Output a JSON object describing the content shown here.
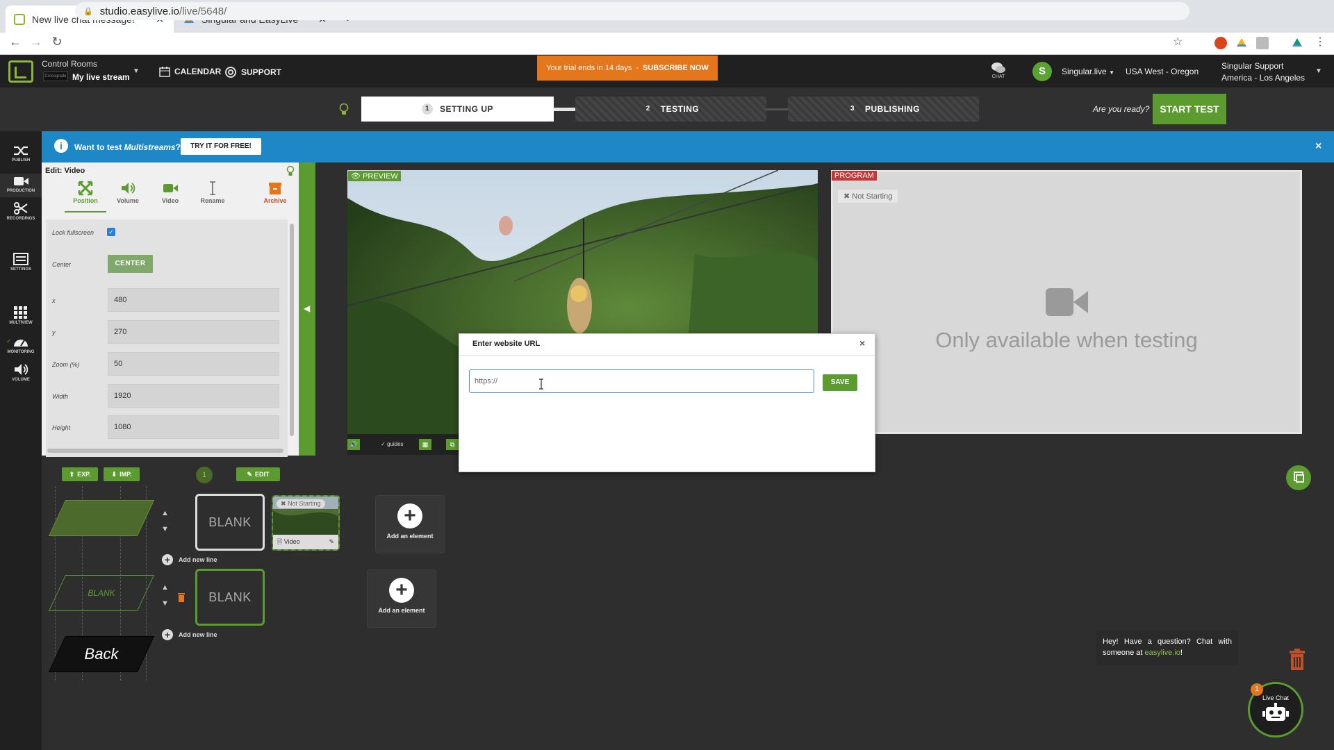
{
  "browser": {
    "tabs": [
      {
        "title": "New live chat message!",
        "icon": "easylive-icon"
      },
      {
        "title": "Singular and EasyLive",
        "icon": "google-drive-icon"
      }
    ],
    "new_tab": "+",
    "url_host": "studio.easylive.io",
    "url_path": "/live/5648/"
  },
  "topbar": {
    "control_rooms": "Control Rooms",
    "room_thumb_label": "Crossgrade",
    "room_name": "My live stream",
    "calendar": "CALENDAR",
    "support": "SUPPORT",
    "trial_text": "Your trial ends in 14 days",
    "trial_sep": "-",
    "trial_cta": "SUBSCRIBE NOW",
    "chat_label": "CHAT",
    "avatar_letter": "S",
    "account": "Singular.live",
    "region": "USA West - Oregon",
    "support_name": "Singular Support",
    "support_tz": "America - Los Angeles"
  },
  "steps": [
    {
      "num": "1",
      "label": "SETTING UP"
    },
    {
      "num": "2",
      "label": "TESTING"
    },
    {
      "num": "3",
      "label": "PUBLISHING"
    }
  ],
  "ready_text": "Are you ready?",
  "start_test": "START TEST",
  "sidebar": [
    "PUBLISH",
    "PRODUCTION",
    "RECORDINGS",
    "SETTINGS",
    "MULTIVIEW",
    "MONITORING",
    "VOLUME"
  ],
  "banner": {
    "info": "i",
    "text_before": "Want to test ",
    "text_em": "Multistreams",
    "text_after": "?",
    "cta": "TRY IT FOR FREE!",
    "close": "×"
  },
  "edit": {
    "title": "Edit: Video",
    "tabs": [
      "Position",
      "Volume",
      "Video",
      "Rename",
      "Archive"
    ],
    "lock_label": "Lock fullscreen",
    "lock_checked": true,
    "center_label": "Center",
    "center_button": "CENTER",
    "fields": [
      {
        "label": "x",
        "value": "480"
      },
      {
        "label": "y",
        "value": "270"
      },
      {
        "label": "Zoom (%)",
        "value": "50"
      },
      {
        "label": "Width",
        "value": "1920"
      },
      {
        "label": "Height",
        "value": "1080"
      }
    ]
  },
  "preview": {
    "tag": "PREVIEW",
    "guides": "guides"
  },
  "program": {
    "tag": "PROGRAM",
    "status": "Not Starting",
    "message": "Only available when testing"
  },
  "modal": {
    "title": "Enter website URL",
    "close": "×",
    "url_value": "https://",
    "save": "SAVE"
  },
  "bottom": {
    "exp": "EXP.",
    "imp": "IMP.",
    "layer_num": "1",
    "edit": "EDIT",
    "layers": [
      "",
      "BLANK",
      "Back"
    ],
    "blank": "BLANK",
    "video_status": "Not Starting",
    "video_label": "Video",
    "add_line": "Add new line",
    "add_element": "Add an element"
  },
  "chat": {
    "bubble_text": "Hey! Have a question? Chat with someone at ",
    "bubble_link": "easylive.io",
    "bubble_end": "!",
    "live_chat": "Live Chat",
    "badge": "1"
  },
  "colors": {
    "accent_green": "#5c9b30",
    "banner_blue": "#1e88c7",
    "trial_orange": "#e4761b",
    "program_red": "#c13838"
  }
}
